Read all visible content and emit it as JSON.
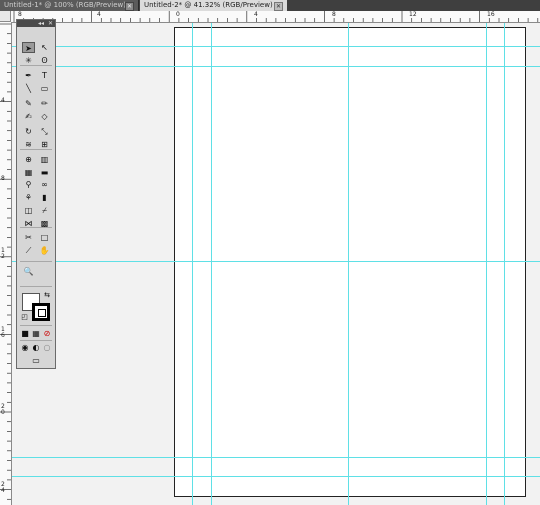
{
  "tabs": [
    {
      "label": "Untitled-1* @ 100% (RGB/Preview)",
      "close": "✕"
    },
    {
      "label": "Untitled-2* @ 41.32% (RGB/Preview)",
      "close": "✕"
    }
  ],
  "ruler_top": [
    "8",
    "0",
    "4",
    "8",
    "12",
    "16"
  ],
  "ruler_left": [
    "4",
    "8",
    "1 2",
    "1 6",
    "2 0",
    "2 4"
  ],
  "tools_panel": {
    "collapse": "◂◂",
    "close": "✕",
    "tools": [
      {
        "name": "selection-tool",
        "glyph": "➤"
      },
      {
        "name": "direct-selection-tool",
        "glyph": "↖"
      },
      {
        "name": "magic-wand-tool",
        "glyph": "✳"
      },
      {
        "name": "lasso-tool",
        "glyph": "ʘ"
      },
      {
        "name": "pen-tool",
        "glyph": "✒"
      },
      {
        "name": "type-tool",
        "glyph": "T"
      },
      {
        "name": "line-segment-tool",
        "glyph": "╲"
      },
      {
        "name": "rectangle-tool",
        "glyph": "▭"
      },
      {
        "name": "paintbrush-tool",
        "glyph": "✎"
      },
      {
        "name": "pencil-tool",
        "glyph": "✏"
      },
      {
        "name": "blob-brush-tool",
        "glyph": "✍"
      },
      {
        "name": "eraser-tool",
        "glyph": "◇"
      },
      {
        "name": "rotate-tool",
        "glyph": "↻"
      },
      {
        "name": "scale-tool",
        "glyph": "⤡"
      },
      {
        "name": "warp-tool",
        "glyph": "≋"
      },
      {
        "name": "free-transform-tool",
        "glyph": "⊞"
      },
      {
        "name": "shape-builder-tool",
        "glyph": "⊕"
      },
      {
        "name": "perspective-grid-tool",
        "glyph": "▥"
      },
      {
        "name": "mesh-tool",
        "glyph": "▦"
      },
      {
        "name": "gradient-tool",
        "glyph": "▬"
      },
      {
        "name": "eyedropper-tool",
        "glyph": "⚲"
      },
      {
        "name": "blend-tool",
        "glyph": "∞"
      },
      {
        "name": "symbol-sprayer-tool",
        "glyph": "⚘"
      },
      {
        "name": "column-graph-tool",
        "glyph": "▮"
      },
      {
        "name": "artboard-tool",
        "glyph": "◫"
      },
      {
        "name": "slice-tool",
        "glyph": "⌿"
      },
      {
        "name": "width-tool",
        "glyph": "⋈"
      },
      {
        "name": "mesh-grid-tool",
        "glyph": "▩"
      },
      {
        "name": "knife-tool",
        "glyph": "✂"
      },
      {
        "name": "rectangle-grid-tool",
        "glyph": "□"
      },
      {
        "name": "measure-tool",
        "glyph": "⟋"
      },
      {
        "name": "hand-tool",
        "glyph": "✋"
      },
      {
        "name": "zoom-tool",
        "glyph": "🔍"
      }
    ],
    "swap": "⇆",
    "default": "◰",
    "color_mode": [
      "■",
      "▦",
      "⊘"
    ],
    "draw_modes": [
      "◉",
      "◐",
      "○"
    ],
    "screen_mode": "▭"
  }
}
